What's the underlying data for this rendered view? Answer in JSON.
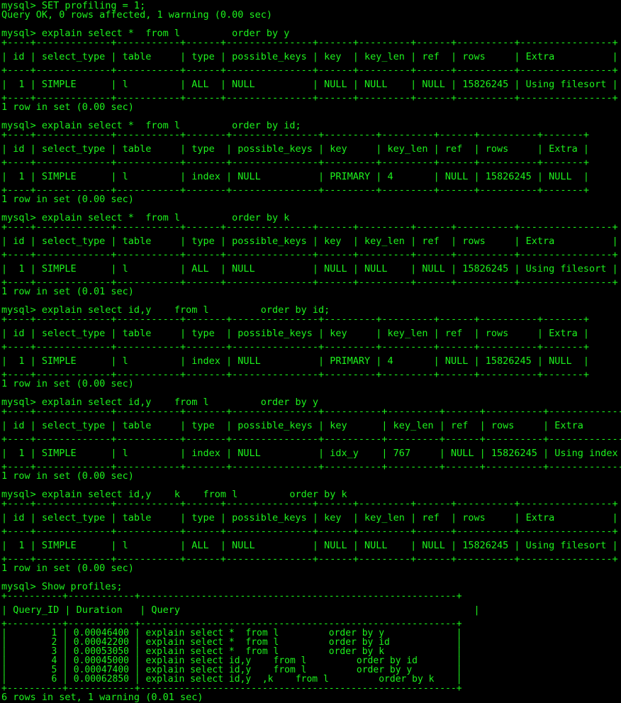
{
  "colors": {
    "background": "#000000",
    "text": "#1df21d",
    "redaction": "#0b5c0b"
  },
  "lines": [
    {
      "kind": "line",
      "text": "mysql> SET profiling = 1;"
    },
    {
      "kind": "line",
      "text": "Query OK, 0 rows affected, 1 warning (0.00 sec)"
    },
    {
      "kind": "gap"
    },
    {
      "kind": "line",
      "text": "mysql> explain select *  from l         order by y"
    },
    {
      "kind": "line",
      "text": "+----+-------------+-----------+------+---------------+------+---------+------+----------+----------------+"
    },
    {
      "kind": "tline",
      "text": "| id | select_type | table     | type | possible_keys | key  | key_len | ref  | rows     | Extra          |"
    },
    {
      "kind": "line",
      "text": "+----+-------------+-----------+------+---------------+------+---------+------+----------+----------------+"
    },
    {
      "kind": "tline",
      "text": "|  1 | SIMPLE      | l         | ALL  | NULL          | NULL | NULL    | NULL | 15826245 | Using filesort |"
    },
    {
      "kind": "line",
      "text": "+----+-------------+-----------+------+---------------+------+---------+------+----------+----------------+"
    },
    {
      "kind": "line",
      "text": "1 row in set (0.00 sec)"
    },
    {
      "kind": "gap"
    },
    {
      "kind": "line",
      "text": "mysql> explain select *  from l         order by id;"
    },
    {
      "kind": "line",
      "text": "+----+-------------+-----------+-------+---------------+---------+---------+------+----------+-------+"
    },
    {
      "kind": "tline",
      "text": "| id | select_type | table     | type  | possible_keys | key     | key_len | ref  | rows     | Extra |"
    },
    {
      "kind": "line",
      "text": "+----+-------------+-----------+-------+---------------+---------+---------+------+----------+-------+"
    },
    {
      "kind": "tline",
      "text": "|  1 | SIMPLE      | l         | index | NULL          | PRIMARY | 4       | NULL | 15826245 | NULL  |"
    },
    {
      "kind": "line",
      "text": "+----+-------------+-----------+-------+---------------+---------+---------+------+----------+-------+"
    },
    {
      "kind": "line",
      "text": "1 row in set (0.00 sec)"
    },
    {
      "kind": "gap"
    },
    {
      "kind": "line",
      "text": "mysql> explain select *  from l         order by k"
    },
    {
      "kind": "line",
      "text": "+----+-------------+-----------+------+---------------+------+---------+------+----------+----------------+"
    },
    {
      "kind": "tline",
      "text": "| id | select_type | table     | type | possible_keys | key  | key_len | ref  | rows     | Extra          |"
    },
    {
      "kind": "line",
      "text": "+----+-------------+-----------+------+---------------+------+---------+------+----------+----------------+"
    },
    {
      "kind": "tline",
      "text": "|  1 | SIMPLE      | l         | ALL  | NULL          | NULL | NULL    | NULL | 15826245 | Using filesort |"
    },
    {
      "kind": "line",
      "text": "+----+-------------+-----------+------+---------------+------+---------+------+----------+----------------+"
    },
    {
      "kind": "line",
      "text": "1 row in set (0.01 sec)"
    },
    {
      "kind": "gap"
    },
    {
      "kind": "line",
      "text": "mysql> explain select id,y    from l         order by id;"
    },
    {
      "kind": "line",
      "text": "+----+-------------+-----------+-------+---------------+---------+---------+------+----------+-------+"
    },
    {
      "kind": "tline",
      "text": "| id | select_type | table     | type  | possible_keys | key     | key_len | ref  | rows     | Extra |"
    },
    {
      "kind": "line",
      "text": "+----+-------------+-----------+-------+---------------+---------+---------+------+----------+-------+"
    },
    {
      "kind": "tline",
      "text": "|  1 | SIMPLE      | l         | index | NULL          | PRIMARY | 4       | NULL | 15826245 | NULL  |"
    },
    {
      "kind": "line",
      "text": "+----+-------------+-----------+-------+---------------+---------+---------+------+----------+-------+"
    },
    {
      "kind": "line",
      "text": "1 row in set (0.00 sec)"
    },
    {
      "kind": "gap"
    },
    {
      "kind": "line",
      "text": "mysql> explain select id,y    from l         order by y"
    },
    {
      "kind": "line",
      "text": "+----+-------------+-----------+-------+---------------+----------+---------+------+----------+-------------+"
    },
    {
      "kind": "tline",
      "text": "| id | select_type | table     | type  | possible_keys | key      | key_len | ref  | rows     | Extra       |"
    },
    {
      "kind": "line",
      "text": "+----+-------------+-----------+-------+---------------+----------+---------+------+----------+-------------+"
    },
    {
      "kind": "tline",
      "text": "|  1 | SIMPLE      | l         | index | NULL          | idx_y    | 767     | NULL | 15826245 | Using index |"
    },
    {
      "kind": "line",
      "text": "+----+-------------+-----------+-------+---------------+----------+---------+------+----------+-------------+"
    },
    {
      "kind": "line",
      "text": "1 row in set (0.00 sec)"
    },
    {
      "kind": "gap"
    },
    {
      "kind": "line",
      "text": "mysql> explain select id,y    k    from l         order by k"
    },
    {
      "kind": "line",
      "text": "+----+-------------+-----------+------+---------------+------+---------+------+----------+----------------+"
    },
    {
      "kind": "tline",
      "text": "| id | select_type | table     | type | possible_keys | key  | key_len | ref  | rows     | Extra          |"
    },
    {
      "kind": "line",
      "text": "+----+-------------+-----------+------+---------------+------+---------+------+----------+----------------+"
    },
    {
      "kind": "tline",
      "text": "|  1 | SIMPLE      | l         | ALL  | NULL          | NULL | NULL    | NULL | 15826245 | Using filesort |"
    },
    {
      "kind": "line",
      "text": "+----+-------------+-----------+------+---------------+------+---------+------+----------+----------------+"
    },
    {
      "kind": "line",
      "text": "1 row in set (0.00 sec)"
    },
    {
      "kind": "gap"
    },
    {
      "kind": "line",
      "text": "mysql> Show profiles;"
    },
    {
      "kind": "prof",
      "text": "+----------+------------+---------------------------------------------------------+"
    },
    {
      "kind": "tline",
      "text": "| Query_ID | Duration   | Query                                                   |"
    },
    {
      "kind": "prof",
      "text": "+----------+------------+---------------------------------------------------------+"
    },
    {
      "kind": "prof",
      "text": "|        1 | 0.00046400 | explain select *  from l         order by y             |"
    },
    {
      "kind": "prof",
      "text": "|        2 | 0.00042200 | explain select *  from l         order by id            |"
    },
    {
      "kind": "prof",
      "text": "|        3 | 0.00053050 | explain select *  from l         order by k             |"
    },
    {
      "kind": "prof",
      "text": "|        4 | 0.00045000 | explain select id,y    from l         order by id       |"
    },
    {
      "kind": "prof",
      "text": "|        5 | 0.00047400 | explain select id,y    from l         order by y        |"
    },
    {
      "kind": "prof",
      "text": "|        6 | 0.00062850 | explain select id,y  ,k    from l         order by k    |"
    },
    {
      "kind": "prof",
      "text": "+----------+------------+---------------------------------------------------------+"
    },
    {
      "kind": "line",
      "text": "6 rows in set, 1 warning (0.01 sec)"
    }
  ]
}
